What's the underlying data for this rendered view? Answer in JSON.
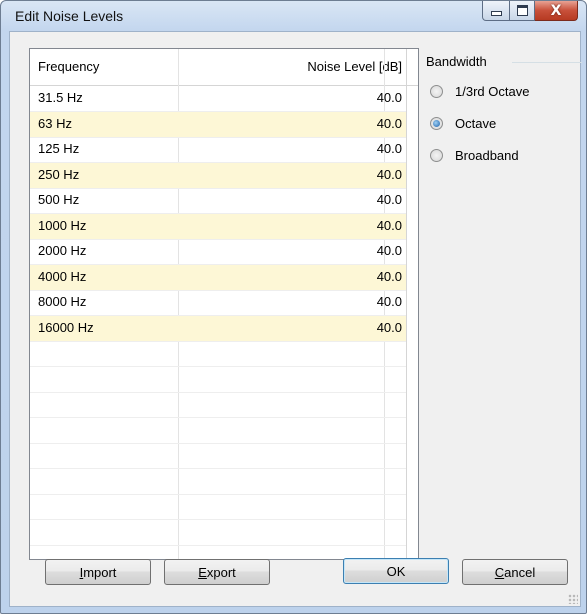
{
  "window": {
    "title": "Edit Noise Levels",
    "close_glyph": "X"
  },
  "table": {
    "headers": {
      "frequency": "Frequency",
      "level": "Noise Level [dB]"
    },
    "rows": [
      {
        "frequency": "31.5 Hz",
        "level": "40.0"
      },
      {
        "frequency": "63 Hz",
        "level": "40.0"
      },
      {
        "frequency": "125 Hz",
        "level": "40.0"
      },
      {
        "frequency": "250 Hz",
        "level": "40.0"
      },
      {
        "frequency": "500 Hz",
        "level": "40.0"
      },
      {
        "frequency": "1000 Hz",
        "level": "40.0"
      },
      {
        "frequency": "2000 Hz",
        "level": "40.0"
      },
      {
        "frequency": "4000 Hz",
        "level": "40.0"
      },
      {
        "frequency": "8000 Hz",
        "level": "40.0"
      },
      {
        "frequency": "16000 Hz",
        "level": "40.0"
      }
    ]
  },
  "bandwidth": {
    "title": "Bandwidth",
    "options": [
      {
        "label": "1/3rd Octave",
        "checked": false
      },
      {
        "label": "Octave",
        "checked": true
      },
      {
        "label": "Broadband",
        "checked": false
      }
    ]
  },
  "buttons": {
    "import": {
      "accel": "I",
      "rest": "mport"
    },
    "export": {
      "accel": "E",
      "rest": "xport"
    },
    "ok": "OK",
    "cancel": {
      "accel": "C",
      "rest": "ancel"
    }
  },
  "colors": {
    "alt_row": "#fdf7d6",
    "radio_selected": "#1a5fa8"
  }
}
